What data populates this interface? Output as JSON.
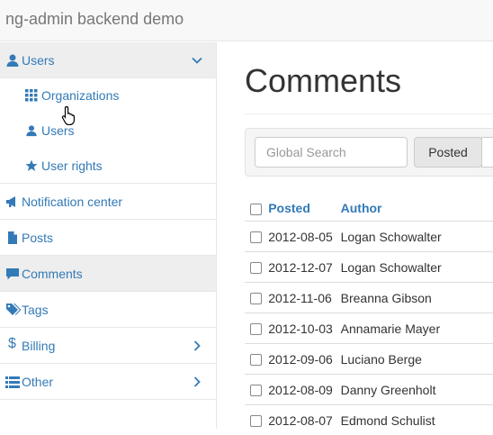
{
  "header": {
    "brand": "ng-admin backend demo"
  },
  "sidebar": {
    "users_group": "Users",
    "submenu": [
      {
        "label": "Organizations",
        "icon": "grid-icon"
      },
      {
        "label": "Users",
        "icon": "user-icon"
      },
      {
        "label": "User rights",
        "icon": "star-icon"
      }
    ],
    "items": [
      {
        "label": "Notification center",
        "icon": "megaphone-icon"
      },
      {
        "label": "Posts",
        "icon": "file-icon"
      },
      {
        "label": "Comments",
        "icon": "comment-icon"
      },
      {
        "label": "Tags",
        "icon": "tags-icon"
      },
      {
        "label": "Billing",
        "icon": "dollar-icon"
      },
      {
        "label": "Other",
        "icon": "list-icon"
      }
    ]
  },
  "main": {
    "title": "Comments",
    "search_placeholder": "Global Search",
    "filter_posted": "Posted",
    "table": {
      "headers": [
        "Posted",
        "Author"
      ],
      "rows": [
        [
          "2012-08-05",
          "Logan Schowalter"
        ],
        [
          "2012-12-07",
          "Logan Schowalter"
        ],
        [
          "2012-11-06",
          "Breanna Gibson"
        ],
        [
          "2012-10-03",
          "Annamarie Mayer"
        ],
        [
          "2012-09-06",
          "Luciano Berge"
        ],
        [
          "2012-08-09",
          "Danny Greenholt"
        ],
        [
          "2012-08-07",
          "Edmond Schulist"
        ]
      ]
    }
  },
  "colors": {
    "link": "#337ab7",
    "active_bg": "#eeeeee"
  }
}
